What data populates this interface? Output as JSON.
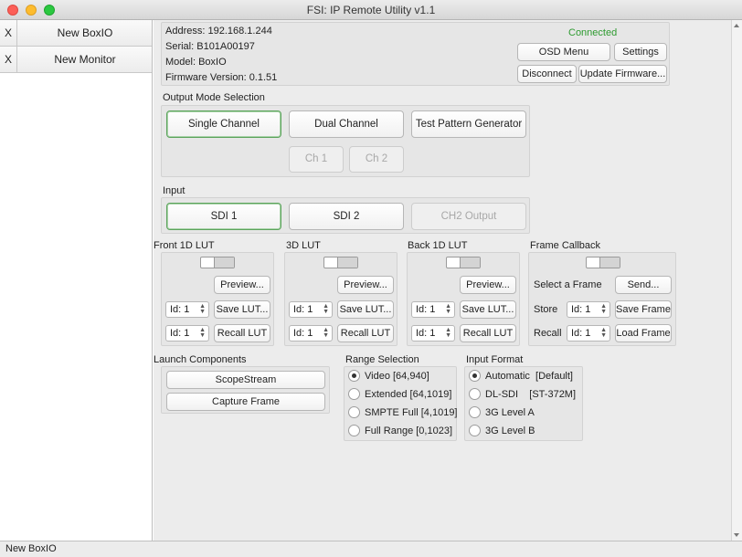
{
  "window": {
    "title": "FSI: IP Remote Utility v1.1"
  },
  "sidebar": {
    "items": [
      {
        "close": "X",
        "label": "New BoxIO"
      },
      {
        "close": "X",
        "label": "New Monitor"
      }
    ]
  },
  "device": {
    "address": "Address: 192.168.1.244",
    "serial": "Serial: B101A00197",
    "model": "Model: BoxIO",
    "firmware": "Firmware Version: 0.1.51",
    "status": "Connected",
    "buttons": {
      "osd": "OSD Menu",
      "settings": "Settings",
      "disconnect": "Disconnect",
      "update": "Update Firmware..."
    }
  },
  "output_mode": {
    "heading": "Output Mode Selection",
    "single": "Single Channel",
    "dual": "Dual Channel",
    "test": "Test Pattern Generator",
    "ch1": "Ch 1",
    "ch2": "Ch 2"
  },
  "input": {
    "heading": "Input",
    "sdi1": "SDI 1",
    "sdi2": "SDI 2",
    "ch2out": "CH2 Output"
  },
  "luts": [
    {
      "heading": "Front 1D LUT",
      "preview": "Preview...",
      "id1": "Id: 1",
      "save": "Save LUT...",
      "id2": "Id: 1",
      "recall": "Recall LUT"
    },
    {
      "heading": "3D LUT",
      "preview": "Preview...",
      "id1": "Id: 1",
      "save": "Save LUT...",
      "id2": "Id: 1",
      "recall": "Recall LUT"
    },
    {
      "heading": "Back 1D LUT",
      "preview": "Preview...",
      "id1": "Id: 1",
      "save": "Save LUT...",
      "id2": "Id: 1",
      "recall": "Recall LUT"
    }
  ],
  "frame_callback": {
    "heading": "Frame Callback",
    "select": "Select a Frame",
    "send": "Send...",
    "store": "Store",
    "store_id": "Id: 1",
    "save": "Save Frame",
    "recall": "Recall",
    "recall_id": "Id: 1",
    "load": "Load Frame"
  },
  "launch": {
    "heading": "Launch Components",
    "scopestream": "ScopeStream",
    "capture": "Capture Frame"
  },
  "range": {
    "heading": "Range Selection",
    "options": [
      "Video [64,940]",
      "Extended [64,1019]",
      "SMPTE Full [4,1019]",
      "Full Range [0,1023]"
    ],
    "selected": "Video [64,940]"
  },
  "input_format": {
    "heading": "Input Format",
    "options": [
      "Automatic  [Default]",
      "DL-SDI    [ST-372M]",
      "3G Level A",
      "3G Level B"
    ],
    "selected": "Automatic  [Default]"
  },
  "status_bar": {
    "text": "New BoxIO"
  },
  "colors": {
    "connected": "#2e9b30",
    "active_border": "#5ba35b"
  }
}
